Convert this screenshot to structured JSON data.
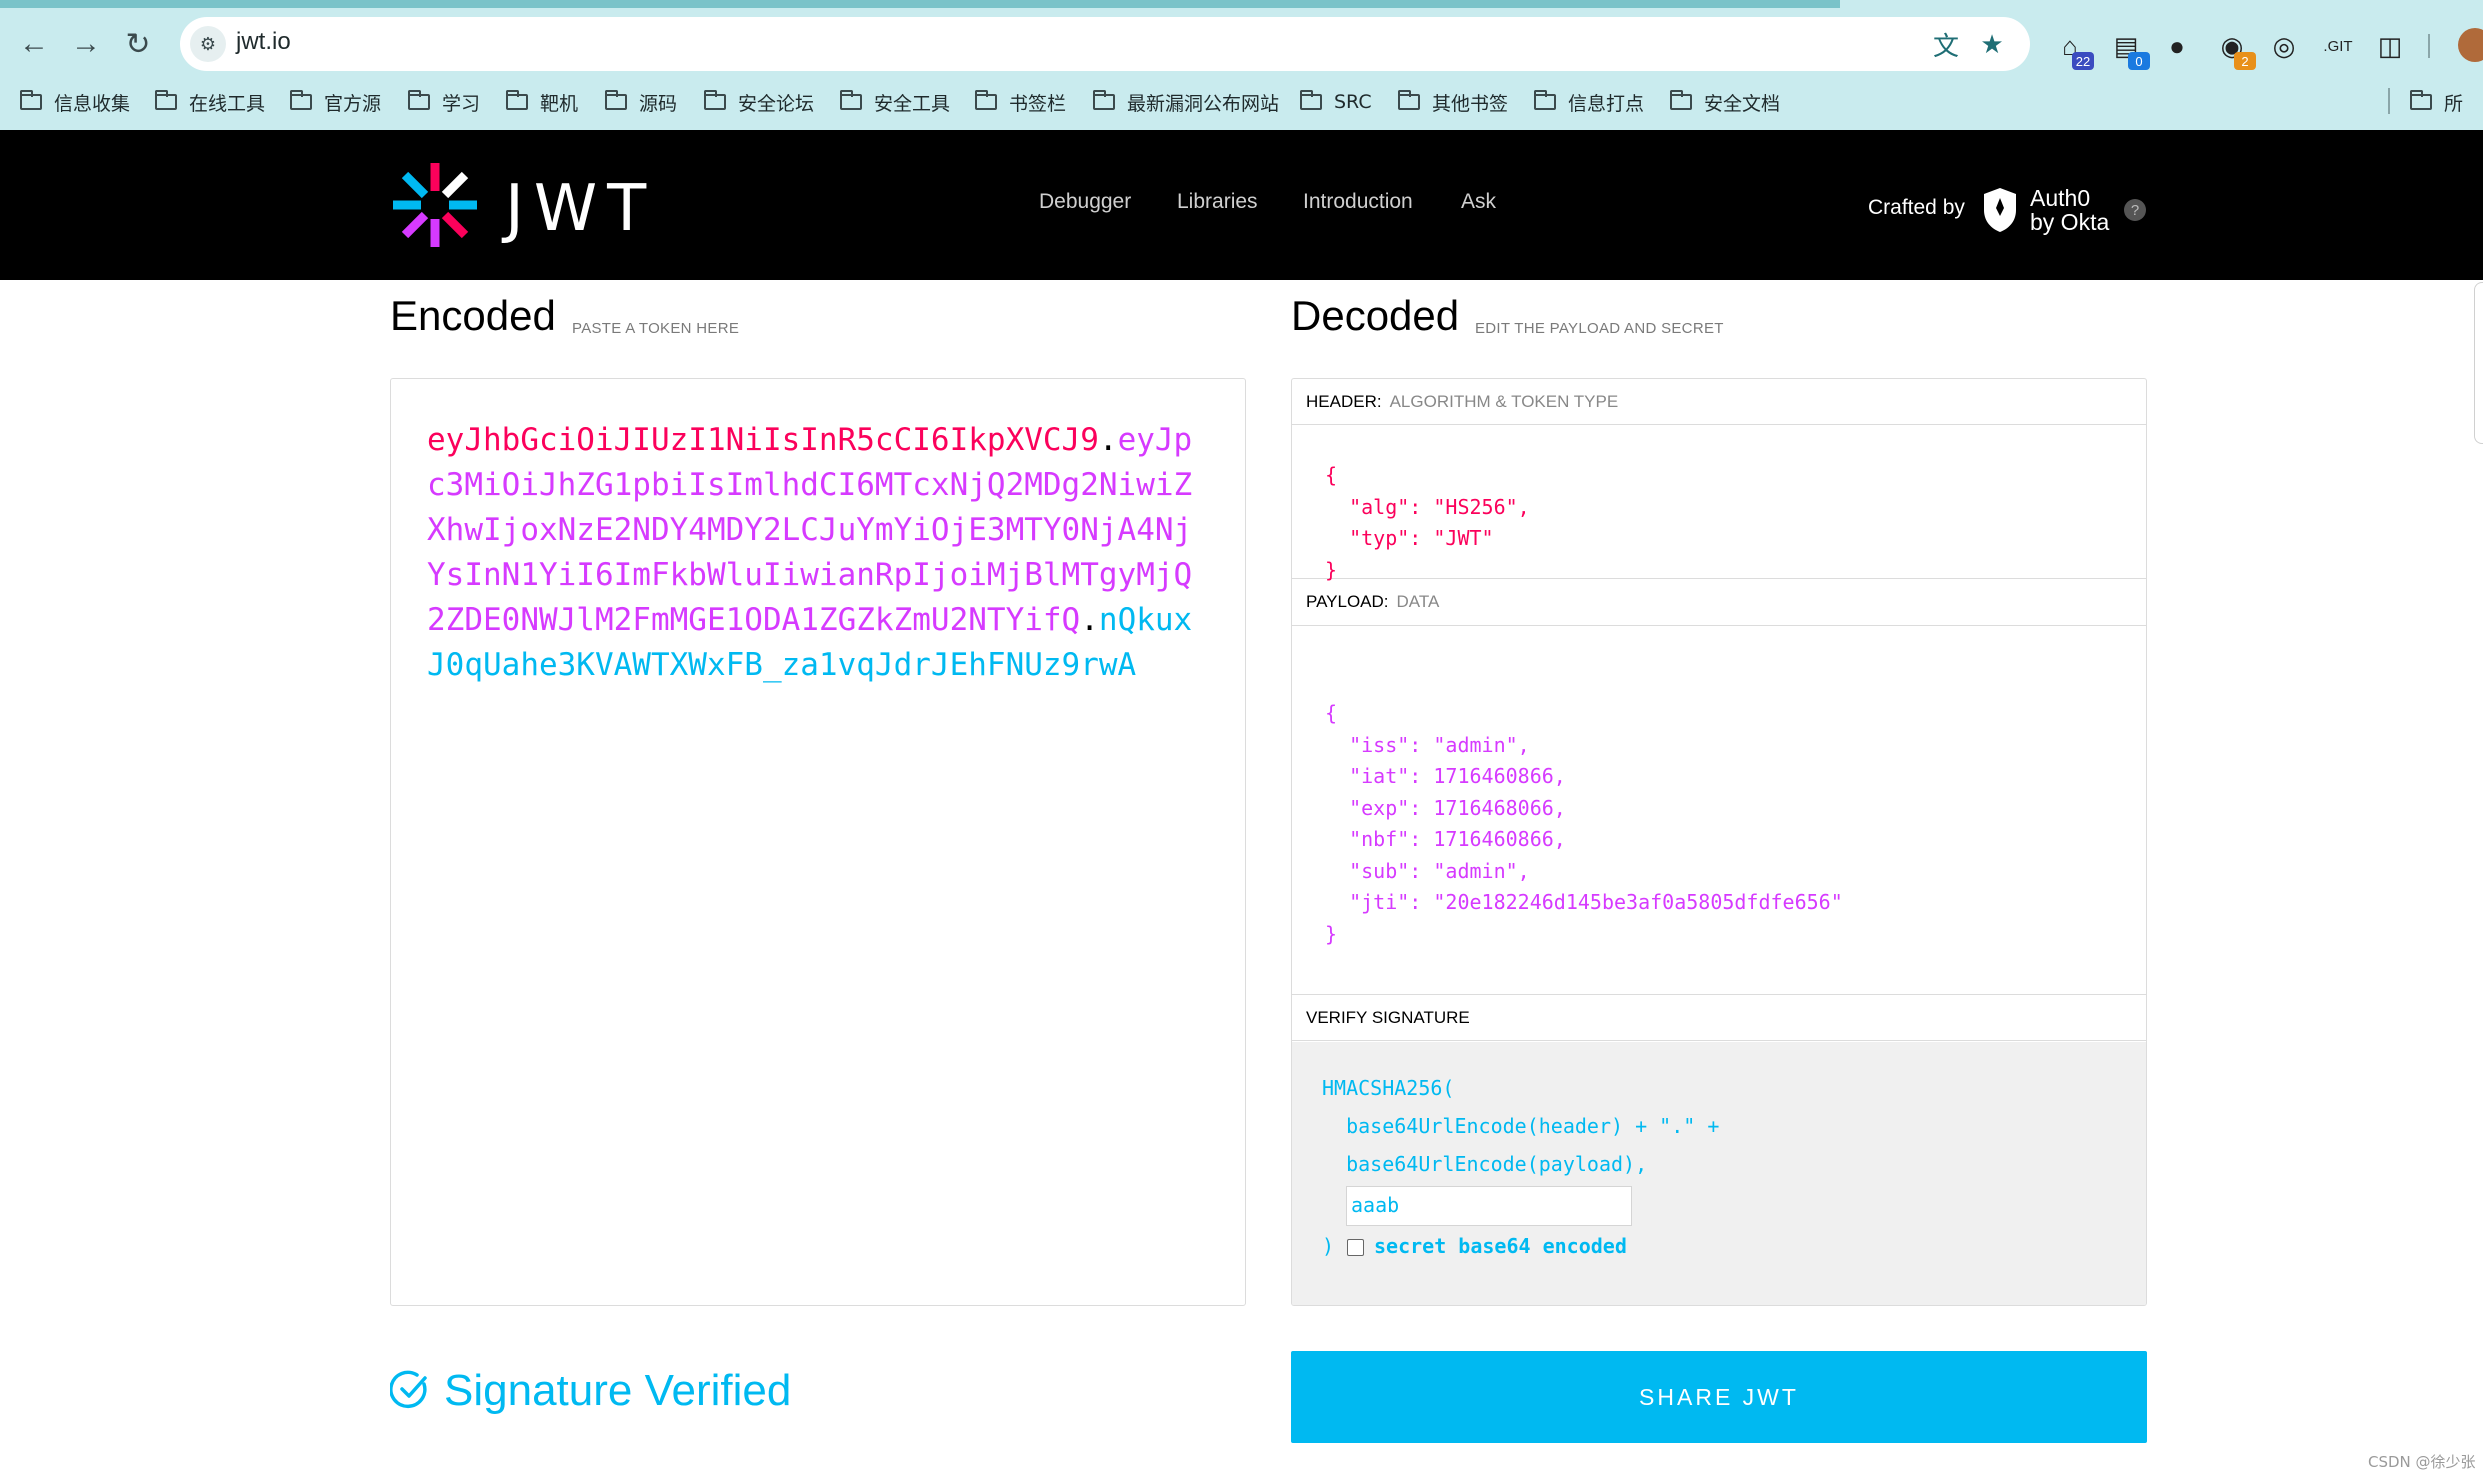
{
  "browser": {
    "url": "jwt.io",
    "extension_badges": [
      "22",
      "0",
      "2"
    ],
    "git_ext_label": ".GIT",
    "bookmarks": [
      "信息收集",
      "在线工具",
      "官方源",
      "学习",
      "靶机",
      "源码",
      "安全论坛",
      "安全工具",
      "书签栏",
      "最新漏洞公布网站",
      "SRC",
      "其他书签",
      "信息打点",
      "安全文档"
    ],
    "bookmark_overflow": "所"
  },
  "site": {
    "logo_text": "JWT",
    "nav": [
      "Debugger",
      "Libraries",
      "Introduction",
      "Ask"
    ],
    "crafted_by": "Crafted by",
    "auth0_line1": "Auth0",
    "auth0_line2": "by Okta",
    "help": "?"
  },
  "encoded": {
    "title": "Encoded",
    "subtitle": "PASTE A TOKEN HERE",
    "token_header": "eyJhbGciOiJIUzI1NiIsInR5cCI6IkpXVCJ9",
    "token_payload": "eyJpc3MiOiJhZG1pbiIsImlhdCI6MTcxNjQ2MDg2NiwiZXhwIjoxNzE2NDY4MDY2LCJuYmYiOjE3MTY0NjA4NjYsInN1YiI6ImFkbWluIiwianRpIjoiMjBlMTgyMjQ2ZDE0NWJlM2FmMGE1ODA1ZGZkZmU2NTYifQ",
    "token_signature": "nQkuxJ0qUahe3KVAWTXWxFB_za1vqJdrJEhFNUz9rwA",
    "dot": "."
  },
  "decoded": {
    "title": "Decoded",
    "subtitle": "EDIT THE PAYLOAD AND SECRET",
    "header_label": "HEADER:",
    "header_sub": "ALGORITHM & TOKEN TYPE",
    "header_json": "{\n  \"alg\": \"HS256\",\n  \"typ\": \"JWT\"\n}",
    "payload_label": "PAYLOAD:",
    "payload_sub": "DATA",
    "payload_json": "{\n  \"iss\": \"admin\",\n  \"iat\": 1716460866,\n  \"exp\": 1716468066,\n  \"nbf\": 1716460866,\n  \"sub\": \"admin\",\n  \"jti\": \"20e182246d145be3af0a5805dfdfe656\"\n}",
    "verify_label": "VERIFY SIGNATURE",
    "verify_line1": "HMACSHA256(",
    "verify_line2": "  base64UrlEncode(header) + \".\" +",
    "verify_line3": "  base64UrlEncode(payload),",
    "secret_value": "aaab",
    "close_paren": ")",
    "checkbox_label": "secret base64 encoded"
  },
  "status": {
    "verified_text": "Signature Verified",
    "share_button": "SHARE JWT"
  },
  "watermark": "CSDN @徐少张",
  "colors": {
    "header": "#fb015b",
    "payload": "#d63aff",
    "signature": "#00b9f1"
  }
}
